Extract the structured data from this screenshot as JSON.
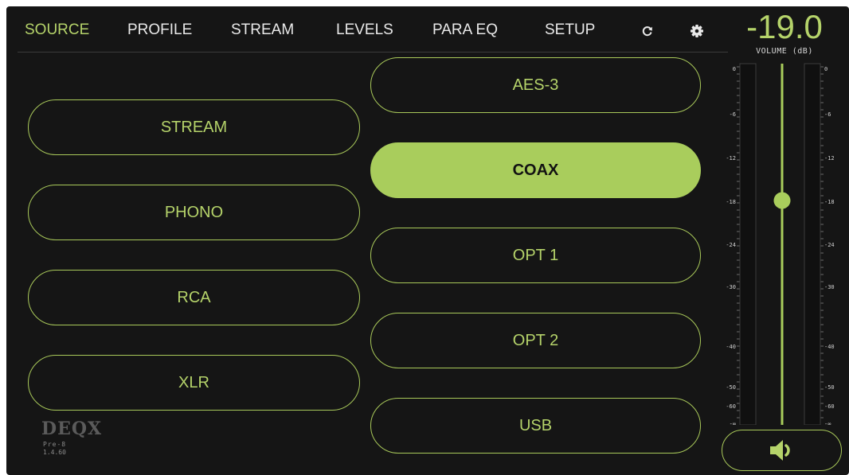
{
  "nav": {
    "items": [
      {
        "label": "SOURCE",
        "active": true
      },
      {
        "label": "PROFILE",
        "active": false
      },
      {
        "label": "STREAM",
        "active": false
      },
      {
        "label": "LEVELS",
        "active": false
      },
      {
        "label": "PARA EQ",
        "active": false
      },
      {
        "label": "SETUP",
        "active": false
      }
    ],
    "icons": [
      "refresh-icon",
      "gear-icon"
    ]
  },
  "sources": {
    "left": [
      "STREAM",
      "PHONO",
      "RCA",
      "XLR"
    ],
    "right": [
      "AES-3",
      "COAX",
      "OPT 1",
      "OPT 2",
      "USB"
    ],
    "selected": "COAX"
  },
  "volume": {
    "value": "-19.0",
    "label": "VOLUME (dB)",
    "scale_left": [
      "0",
      "-6",
      "-12",
      "-18",
      "-24",
      "-30",
      "-40",
      "-50",
      "-60",
      "-∞"
    ],
    "scale_right": [
      "0",
      "-6",
      "-12",
      "-18",
      "-24",
      "-30",
      "-40",
      "-50",
      "-60",
      "-∞"
    ],
    "level_db": -19.0,
    "mute_icon": "speaker-icon"
  },
  "brand": {
    "logo": "DEQX",
    "model": "Pre-8",
    "version": "1.4.60"
  },
  "colors": {
    "accent": "#b5d36a",
    "background": "#151515",
    "selected_fill": "#a9cd5c",
    "text": "#e9e9e9"
  }
}
